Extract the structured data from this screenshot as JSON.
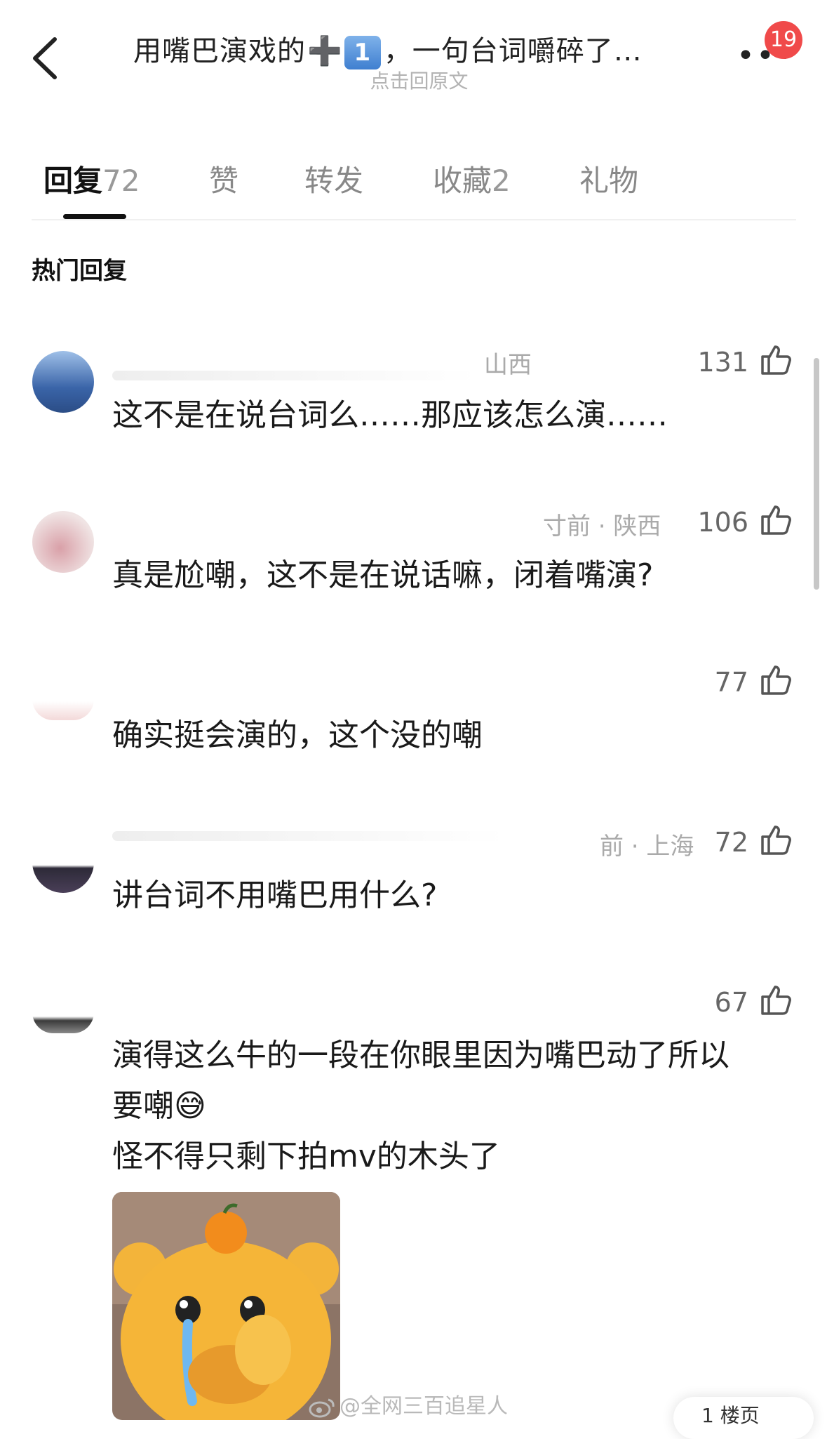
{
  "header": {
    "title_prefix": "用嘴巴演戏的",
    "title_plus": "➕",
    "title_keycap": "1",
    "title_suffix": "，一句台词嚼碎了…",
    "subtitle": "点击回原文",
    "more_label": "•••",
    "notification_count": "19"
  },
  "tabs": [
    {
      "label": "回复",
      "count": "72"
    },
    {
      "label": "赞",
      "count": ""
    },
    {
      "label": "转发",
      "count": ""
    },
    {
      "label": "收藏",
      "count": "2"
    },
    {
      "label": "礼物",
      "count": ""
    }
  ],
  "section_title": "热门回复",
  "comments": [
    {
      "meta": "山西",
      "likes": "131",
      "text": "这不是在说台词么……那应该怎么演……"
    },
    {
      "meta": "寸前 · 陕西",
      "likes": "106",
      "text": "真是尬嘲，这不是在说话嘛，闭着嘴演?"
    },
    {
      "meta": "",
      "likes": "77",
      "text": "确实挺会演的，这个没的嘲"
    },
    {
      "meta": "前 · 上海",
      "likes": "72",
      "text": "讲台词不用嘴巴用什么?"
    },
    {
      "meta": "",
      "likes": "67",
      "text_line1": "演得这么牛的一段在你眼里因为嘴巴动了所以",
      "text_line2": "要嘲",
      "emoji": "😅",
      "text_line3": "怪不得只剩下拍mv的木头了"
    }
  ],
  "watermark": "@全网三百追星人",
  "corner_label": "1 楼页",
  "colors": {
    "badge": "#f04a4a",
    "accent_text": "#111111",
    "muted": "#aaaaaa"
  }
}
